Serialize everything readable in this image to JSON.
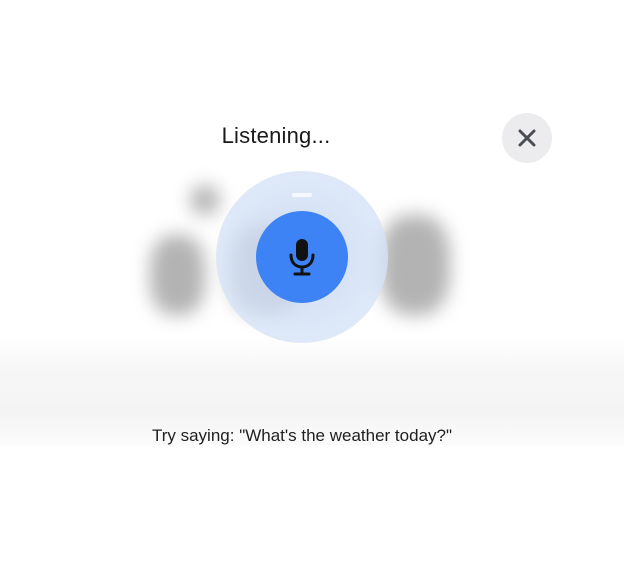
{
  "voice_overlay": {
    "status_text": "Listening...",
    "close_icon": "close-icon",
    "mic_icon": "microphone-icon",
    "hint_text": "Try saying: \"What's the weather today?\"",
    "accent_color": "#3d83f6",
    "ring_color": "#d3e0f4"
  }
}
